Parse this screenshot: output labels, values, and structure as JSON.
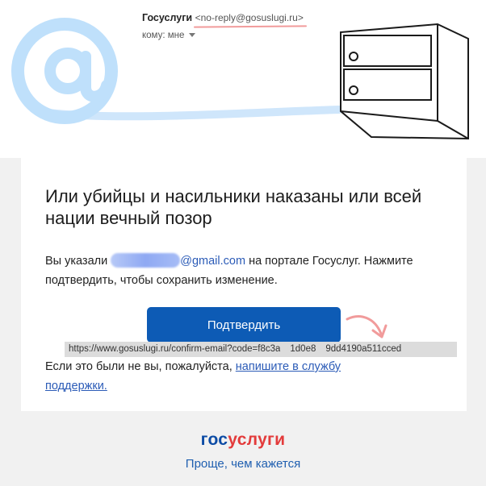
{
  "email": {
    "sender_name": "Госуслуги",
    "sender_address": "<no-reply@gosuslugi.ru>",
    "recipient_label": "кому: мне"
  },
  "card": {
    "title": "Или убийцы и насильники наказаны или всей нации вечный позор",
    "body_prefix": "Вы указали",
    "email_domain": "@gmail.com",
    "body_suffix": " на портале Госуслуг. Нажмите подтвердить, чтобы сохранить изменение.",
    "confirm_button": "Подтвердить",
    "url_part1": "https://www.gosuslugi.ru/confirm-email?code=f8c3a",
    "url_part2": "1d0e8",
    "url_part3": "9dd4190a511cced",
    "support_prefix": "Если это были не вы, пожалуйста, ",
    "support_link": "напишите в службу поддержки."
  },
  "footer": {
    "logo_part1": "гос",
    "logo_part2": "услуги",
    "tagline": "Проще, чем кажется"
  },
  "colors": {
    "button": "#0d5bb5",
    "link": "#2b5bb7",
    "logo_blue": "#0d4ca5",
    "logo_red": "#e33b3b"
  }
}
